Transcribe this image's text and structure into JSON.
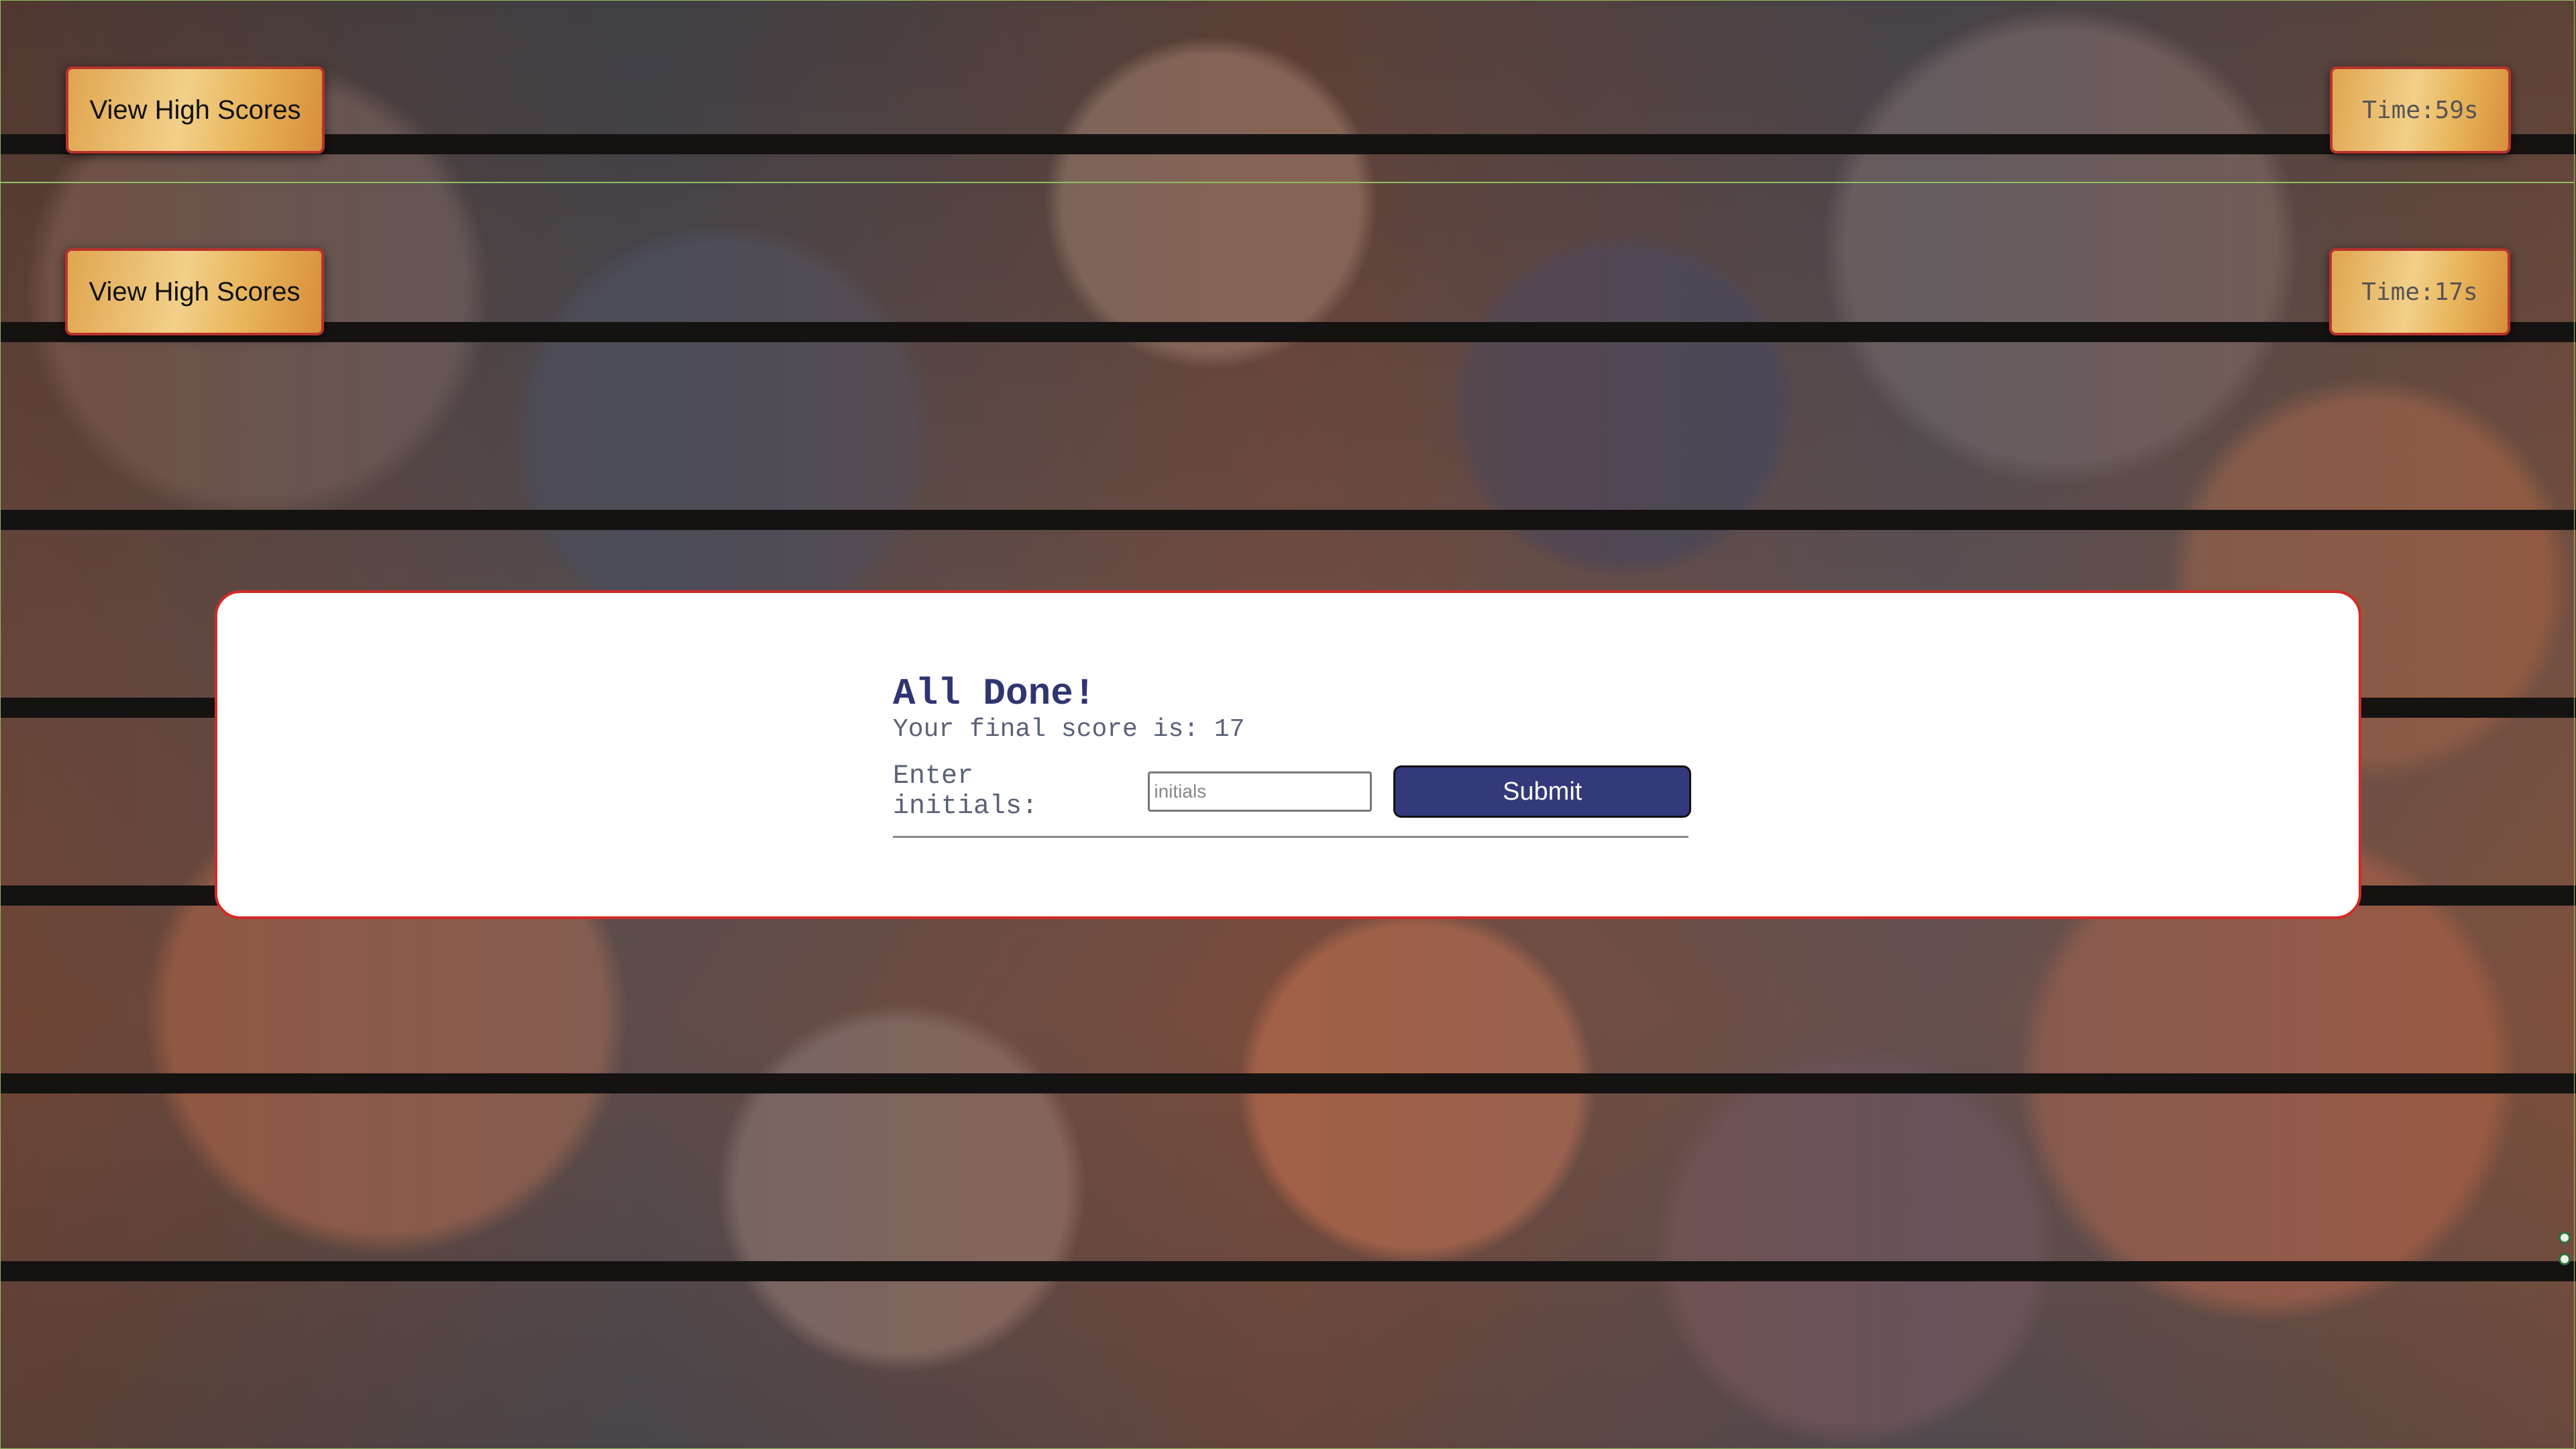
{
  "header_top": {
    "high_scores_label": "View High Scores",
    "timer_text": "Time:59s"
  },
  "header_second": {
    "high_scores_label": "View High Scores",
    "timer_text": "Time:17s"
  },
  "result_modal": {
    "title": "All Done!",
    "score_text": "Your final score is: 17",
    "initials_label": "Enter initials:",
    "initials_placeholder": "initials",
    "initials_value": "",
    "submit_label": "Submit"
  },
  "colors": {
    "accent": "#33397a",
    "border_red": "#d42a26",
    "gold": "#e8b45a"
  }
}
